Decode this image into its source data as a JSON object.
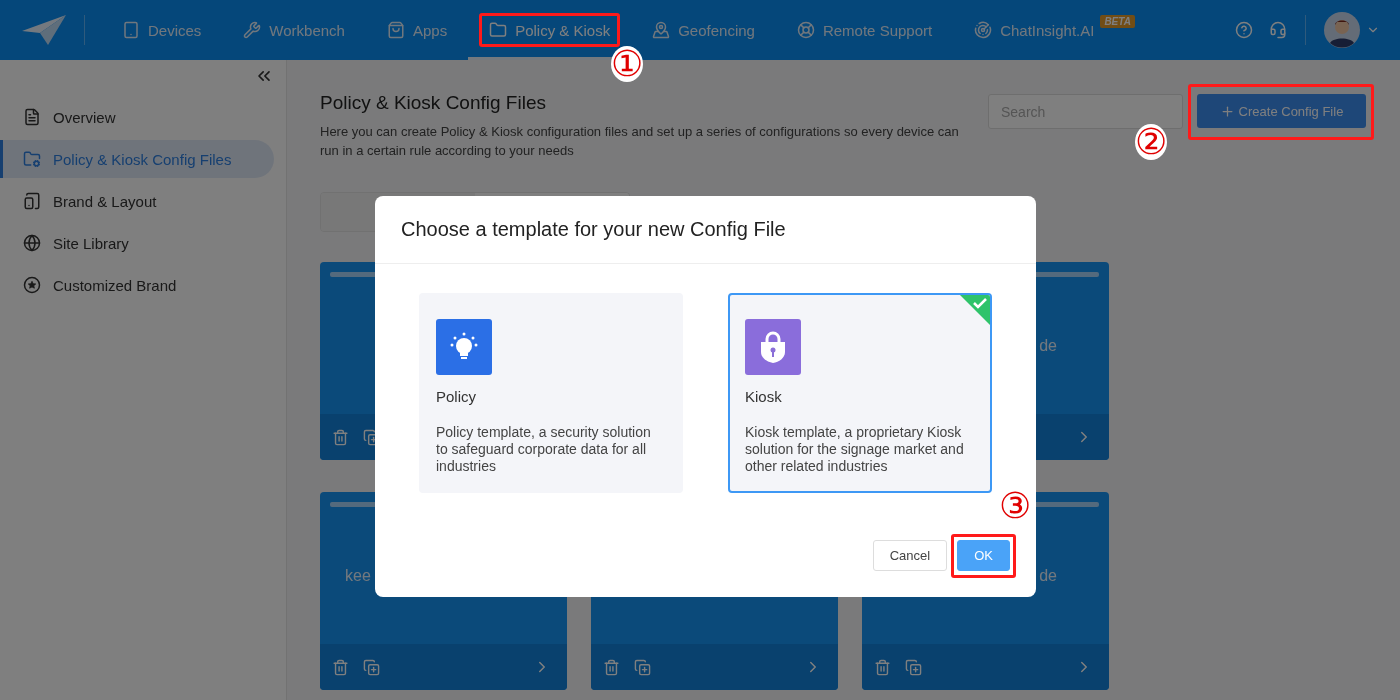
{
  "topbar": {
    "nav": [
      {
        "label": "Devices",
        "selected": false
      },
      {
        "label": "Workbench",
        "selected": false
      },
      {
        "label": "Apps",
        "selected": false
      },
      {
        "label": "Policy & Kiosk",
        "selected": true,
        "annotation": "①"
      },
      {
        "label": "Geofencing",
        "selected": false
      },
      {
        "label": "Remote Support",
        "selected": false
      },
      {
        "label": "ChatInsight.AI",
        "selected": false,
        "badge": "BETA"
      }
    ]
  },
  "sidebar": {
    "items": [
      {
        "label": "Overview",
        "selected": false
      },
      {
        "label": "Policy & Kiosk Config Files",
        "selected": true
      },
      {
        "label": "Brand & Layout",
        "selected": false
      },
      {
        "label": "Site Library",
        "selected": false
      },
      {
        "label": "Customized Brand",
        "selected": false
      }
    ]
  },
  "main": {
    "title": "Policy & Kiosk Config Files",
    "description": "Here you can create Policy & Kiosk configuration files and set up a series of configurations so every device can run in a certain rule according to your needs",
    "search": {
      "placeholder": "Search"
    },
    "create_button": {
      "label": "Create Config File",
      "annotation": "②"
    },
    "cards": [
      {
        "kind": "actions"
      },
      {
        "kind": "chevron",
        "label": "de"
      },
      {
        "kind": "full",
        "label": "kee"
      },
      {
        "kind": "full"
      },
      {
        "kind": "full",
        "label": "de"
      }
    ]
  },
  "dialog": {
    "title": "Choose a template for your new Config File",
    "options": [
      {
        "kind": "policy",
        "name": "Policy",
        "description": "Policy template, a security solution to safeguard corporate data for all industries",
        "selected": false
      },
      {
        "kind": "kiosk",
        "name": "Kiosk",
        "description": "Kiosk template, a proprietary Kiosk solution for the signage market and other related industries",
        "selected": true
      }
    ],
    "cancel": "Cancel",
    "ok": {
      "label": "OK",
      "annotation": "③"
    }
  }
}
